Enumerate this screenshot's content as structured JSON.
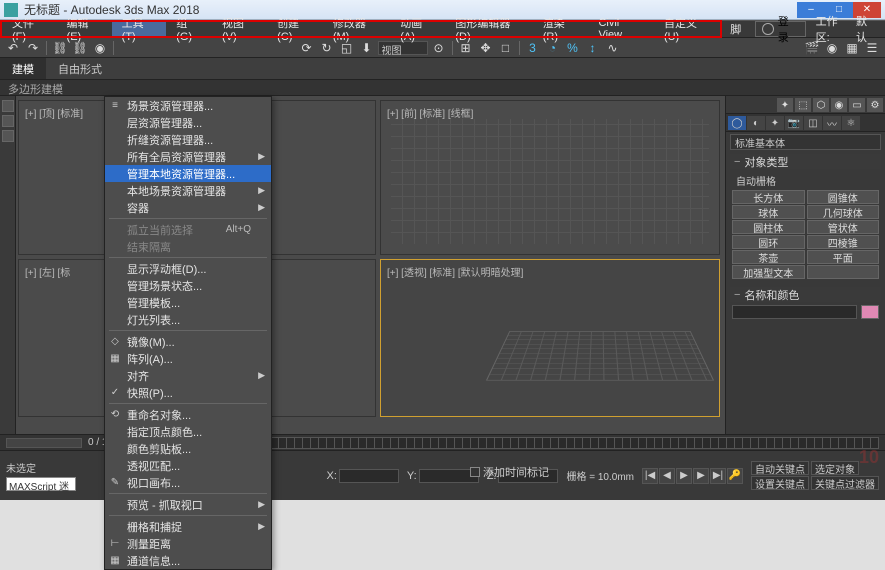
{
  "titlebar": {
    "title": "无标题 - Autodesk 3ds Max 2018"
  },
  "menubar": {
    "items": [
      "文件(F)",
      "编辑(E)",
      "工具(T)",
      "组(G)",
      "视图(V)",
      "创建(C)",
      "修改器(M)",
      "动画(A)",
      "图形编辑器(D)",
      "渲染(R)",
      "Civil View",
      "自定义(U)",
      "脚"
    ],
    "login": "登录",
    "workspace": "工作区:",
    "default": "默认"
  },
  "ribbon": {
    "tabs": [
      "建模",
      "自由形式"
    ],
    "sub": "多边形建模"
  },
  "viewports": {
    "tl": "[+] [顶] [标准]",
    "tr": "[+] [前] [标准] [线框]",
    "bl": "[+] [左] [标",
    "br": "[+] [透视] [标准] [默认明暗处理]"
  },
  "dropdown": {
    "items": [
      {
        "label": "场景资源管理器...",
        "icon": "≡"
      },
      {
        "label": "层资源管理器...",
        "icon": ""
      },
      {
        "label": "折缝资源管理器...",
        "icon": ""
      },
      {
        "label": "所有全局资源管理器",
        "icon": "",
        "arrow": true
      },
      {
        "label": "管理本地资源管理器...",
        "icon": "",
        "hl": true
      },
      {
        "label": "本地场景资源管理器",
        "icon": "",
        "arrow": true
      },
      {
        "label": "容器",
        "icon": "",
        "arrow": true
      },
      {
        "sep": true
      },
      {
        "label": "孤立当前选择",
        "shortcut": "Alt+Q",
        "dis": true
      },
      {
        "label": "结束隔离",
        "dis": true
      },
      {
        "sep": true
      },
      {
        "label": "显示浮动框(D)...",
        "icon": ""
      },
      {
        "label": "管理场景状态...",
        "icon": ""
      },
      {
        "label": "管理模板...",
        "icon": ""
      },
      {
        "label": "灯光列表...",
        "icon": ""
      },
      {
        "sep": true
      },
      {
        "label": "镜像(M)...",
        "icon": "◇"
      },
      {
        "label": "阵列(A)...",
        "icon": "▦"
      },
      {
        "label": "对齐",
        "icon": "",
        "arrow": true
      },
      {
        "label": "快照(P)...",
        "icon": "✓"
      },
      {
        "sep": true
      },
      {
        "label": "重命名对象...",
        "icon": "⟲"
      },
      {
        "label": "指定顶点颜色...",
        "icon": ""
      },
      {
        "label": "颜色剪贴板...",
        "icon": ""
      },
      {
        "label": "透视匹配...",
        "icon": ""
      },
      {
        "label": "视口画布...",
        "icon": "✎"
      },
      {
        "sep": true
      },
      {
        "label": "预览 - 抓取视口",
        "icon": "",
        "arrow": true
      },
      {
        "sep": true
      },
      {
        "label": "栅格和捕捉",
        "icon": "",
        "arrow": true
      },
      {
        "label": "测量距离",
        "icon": "⊢"
      },
      {
        "label": "通道信息...",
        "icon": "▦"
      }
    ]
  },
  "cmdpanel": {
    "dropdown": "标准基本体",
    "rollout1": "对象类型",
    "autogrid": "自动栅格",
    "buttons": [
      [
        "长方体",
        "圆锥体"
      ],
      [
        "球体",
        "几何球体"
      ],
      [
        "圆柱体",
        "管状体"
      ],
      [
        "圆环",
        "四棱锥"
      ],
      [
        "茶壶",
        "平面"
      ],
      [
        "加强型文本",
        ""
      ]
    ],
    "rollout2": "名称和颜色"
  },
  "timeline": {
    "pos": "0 / 100"
  },
  "status": {
    "selnone": "未选定",
    "script": "MAXScript 迷",
    "x": "X:",
    "y": "Y:",
    "z": "Z:",
    "grid": "栅格 = 10.0mm",
    "addtime": "添加时间标记",
    "autokey": "自动关键点",
    "selfilter": "选定对象",
    "setkey": "设置关键点",
    "keyfilter": "关键点过滤器"
  },
  "watermark": "10"
}
